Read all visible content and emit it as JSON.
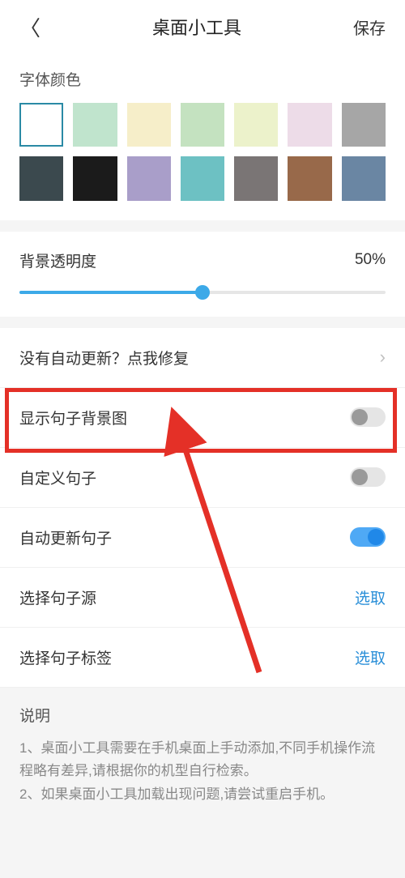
{
  "header": {
    "title": "桌面小工具",
    "save": "保存"
  },
  "font_color": {
    "label": "字体颜色",
    "colors": [
      {
        "hex": "#ffffff",
        "selected": true
      },
      {
        "hex": "#c0e4cd",
        "selected": false
      },
      {
        "hex": "#f6eec9",
        "selected": false
      },
      {
        "hex": "#c4e2c0",
        "selected": false
      },
      {
        "hex": "#ecf2cb",
        "selected": false
      },
      {
        "hex": "#eddce8",
        "selected": false
      },
      {
        "hex": "#a6a6a6",
        "selected": false
      },
      {
        "hex": "#3b494e",
        "selected": false
      },
      {
        "hex": "#1b1b1b",
        "selected": false
      },
      {
        "hex": "#a99ec9",
        "selected": false
      },
      {
        "hex": "#6dc1c3",
        "selected": false
      },
      {
        "hex": "#7a7575",
        "selected": false
      },
      {
        "hex": "#98694a",
        "selected": false
      },
      {
        "hex": "#6a86a3",
        "selected": false
      }
    ]
  },
  "opacity": {
    "label": "背景透明度",
    "value": "50%",
    "percent": 50
  },
  "items": {
    "repair": "没有自动更新？点我修复",
    "show_bg": "显示句子背景图",
    "custom_sentence": "自定义句子",
    "auto_update": "自动更新句子",
    "select_source": "选择句子源",
    "select_tag": "选择句子标签",
    "select_action": "选取"
  },
  "toggles": {
    "show_bg": false,
    "custom_sentence": false,
    "auto_update": true
  },
  "description": {
    "title": "说明",
    "line1": "1、桌面小工具需要在手机桌面上手动添加,不同手机操作流程略有差异,请根据你的机型自行检索。",
    "line2": "2、如果桌面小工具加载出现问题,请尝试重启手机。"
  }
}
